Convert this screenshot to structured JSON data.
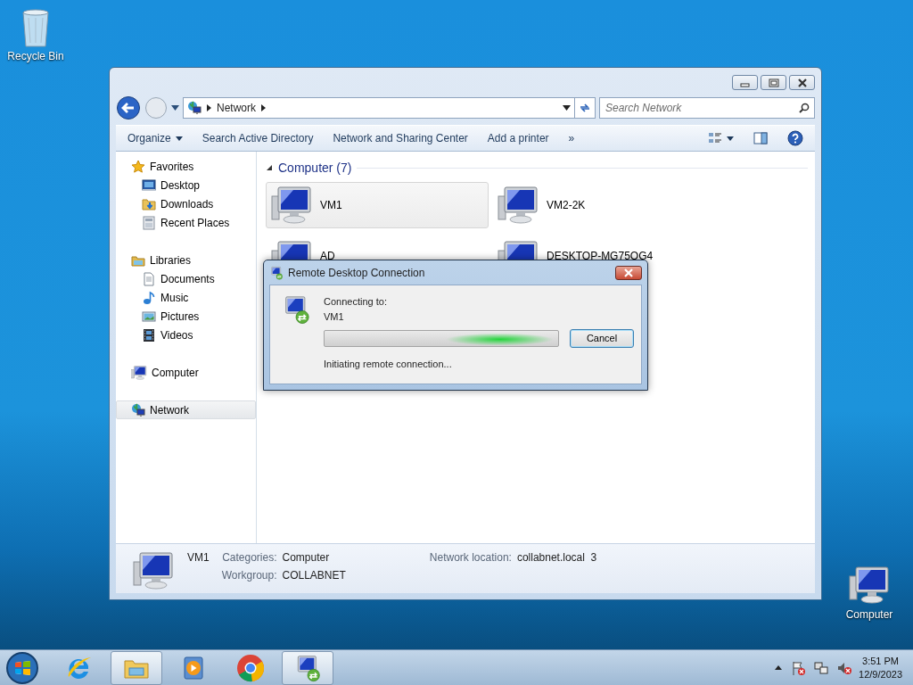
{
  "desktop_icons": [
    {
      "label": "Recycle Bin",
      "kind": "recycle"
    },
    {
      "label": "Computer",
      "kind": "computer"
    }
  ],
  "explorer": {
    "address": [
      "Network"
    ],
    "search": {
      "placeholder": "Search Network"
    },
    "toolbar": [
      {
        "label": "Organize",
        "dropdown": true
      },
      {
        "label": "Search Active Directory",
        "dropdown": false
      },
      {
        "label": "Network and Sharing Center",
        "dropdown": false
      },
      {
        "label": "Add a printer",
        "dropdown": false
      }
    ],
    "toolbar_more": "»",
    "nav": [
      {
        "label": "Favorites",
        "kind": "star",
        "selected": false,
        "children": [
          {
            "label": "Desktop",
            "kind": "desktop",
            "selected": false
          },
          {
            "label": "Downloads",
            "kind": "downloads",
            "selected": false
          },
          {
            "label": "Recent Places",
            "kind": "recent",
            "selected": false
          }
        ]
      },
      {
        "label": "Libraries",
        "kind": "library",
        "selected": false,
        "children": [
          {
            "label": "Documents",
            "kind": "document",
            "selected": false
          },
          {
            "label": "Music",
            "kind": "music",
            "selected": false
          },
          {
            "label": "Pictures",
            "kind": "pictures",
            "selected": false
          },
          {
            "label": "Videos",
            "kind": "videos",
            "selected": false
          }
        ]
      },
      {
        "label": "Computer",
        "kind": "computer",
        "selected": false
      },
      {
        "label": "Network",
        "kind": "network",
        "selected": true
      }
    ],
    "group": {
      "title": "Computer (7)",
      "expanded": true
    },
    "items": [
      {
        "label": "VM1",
        "selected": true
      },
      {
        "label": "VM2-2K",
        "selected": false
      },
      {
        "label": "AD",
        "selected": false
      },
      {
        "label": "DESKTOP-MG75OG4",
        "selected": false
      }
    ],
    "details": {
      "name": "VM1",
      "fields": [
        {
          "label": "Categories:",
          "value": "Computer"
        },
        {
          "label": "Workgroup:",
          "value": "COLLABNET"
        },
        {
          "label": "Network location:",
          "value": "collabnet.local  3"
        }
      ]
    }
  },
  "dialog": {
    "title": "Remote Desktop Connection",
    "progress": {
      "level": 0.75
    },
    "connecting_label": "Connecting to:",
    "target": "VM1",
    "status": "Initiating remote connection...",
    "button": "Cancel"
  },
  "taskbar": {
    "apps": [
      {
        "kind": "ie",
        "open": false
      },
      {
        "kind": "explorer",
        "open": true
      },
      {
        "kind": "media",
        "open": false
      },
      {
        "kind": "chrome",
        "open": false
      },
      {
        "kind": "rdp",
        "open": true
      }
    ],
    "time": "3:51 PM",
    "date": "12/9/2023"
  }
}
